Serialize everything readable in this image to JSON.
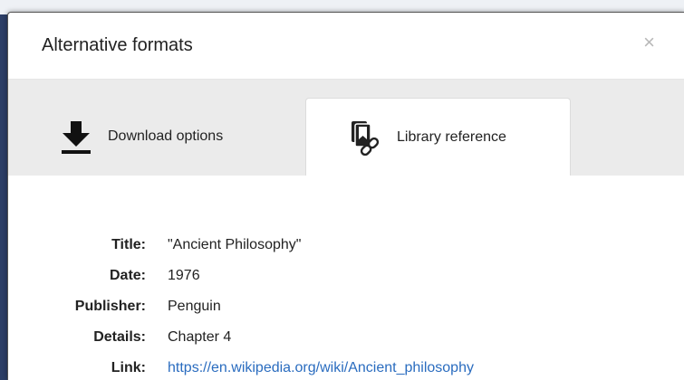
{
  "modal": {
    "title": "Alternative formats",
    "close_label": "×"
  },
  "tabs": [
    {
      "label": "Download options",
      "icon": "download-icon",
      "active": false
    },
    {
      "label": "Library reference",
      "icon": "library-link-icon",
      "active": true
    }
  ],
  "reference": {
    "title_label": "Title:",
    "title_value": "\"Ancient Philosophy\"",
    "date_label": "Date:",
    "date_value": "1976",
    "publisher_label": "Publisher:",
    "publisher_value": "Penguin",
    "details_label": "Details:",
    "details_value": "Chapter 4",
    "link_label": "Link:",
    "link_value": "https://en.wikipedia.org/wiki/Ancient_philosophy"
  },
  "colors": {
    "link": "#2a6cbf",
    "tab_strip": "#ebebeb",
    "backdrop": "#2c3e66"
  }
}
